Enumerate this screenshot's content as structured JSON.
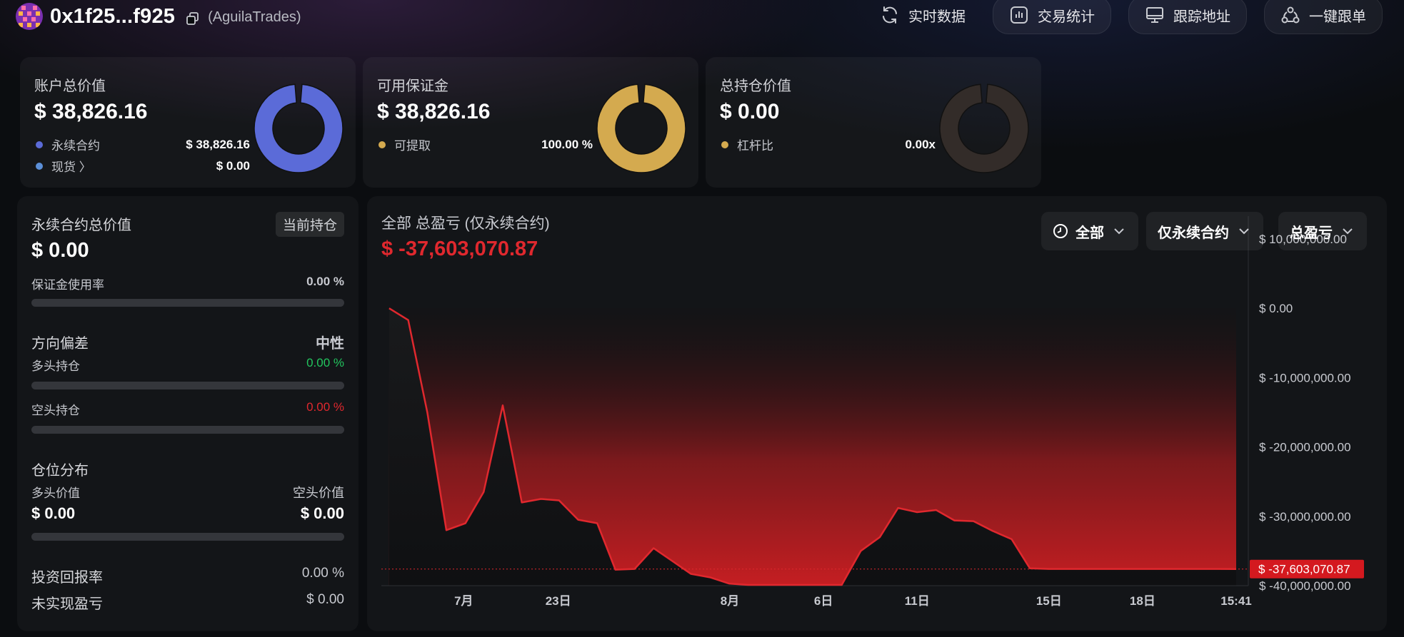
{
  "header": {
    "address": "0x1f25...f925",
    "alias": "(AguilaTrades)",
    "buttons": [
      {
        "label": "实时数据",
        "icon": "refresh-icon"
      },
      {
        "label": "交易统计",
        "icon": "bar-chart-icon"
      },
      {
        "label": "跟踪地址",
        "icon": "monitor-icon"
      },
      {
        "label": "一键跟单",
        "icon": "share-nodes-icon"
      }
    ]
  },
  "cards": [
    {
      "title": "账户总价值",
      "value": "$ 38,826.16",
      "rows": [
        {
          "label": "永续合约",
          "value": "$ 38,826.16",
          "color": "#5b6bd8"
        },
        {
          "label": "现货 〉",
          "value": "$ 0.00",
          "color": "#5b8fd8"
        }
      ],
      "donut_color": "#5b6bd8",
      "donut_fraction": 1.0
    },
    {
      "title": "可用保证金",
      "value": "$ 38,826.16",
      "rows": [
        {
          "label": "可提取",
          "value": "100.00 %",
          "color": "#d4aa4f"
        }
      ],
      "donut_color": "#d4aa4f",
      "donut_fraction": 1.0
    },
    {
      "title": "总持仓价值",
      "value": "$ 0.00",
      "rows": [
        {
          "label": "杠杆比",
          "value": "0.00x",
          "color": "#d4aa4f"
        }
      ],
      "donut_color": "#332c29",
      "donut_fraction": 1.0
    }
  ],
  "left_panel": {
    "title": "永续合约总价值",
    "badge": "当前持仓",
    "value": "$ 0.00",
    "margin_usage_label": "保证金使用率",
    "margin_usage_value": "0.00 %",
    "margin_usage_fraction": 0.0,
    "bias_label": "方向偏差",
    "bias_value": "中性",
    "long_label": "多头持仓",
    "long_value": "0.00 %",
    "long_fraction": 0.0,
    "short_label": "空头持仓",
    "short_value": "0.00 %",
    "short_fraction": 0.0,
    "dist_label": "仓位分布",
    "long_val_label": "多头价值",
    "short_val_label": "空头价值",
    "long_val": "$ 0.00",
    "short_val": "$ 0.00",
    "roi_label": "投资回报率",
    "roi_value": "0.00 %",
    "upnl_label": "未实现盈亏",
    "upnl_value": "$ 0.00",
    "colors": {
      "long": "#22c55e",
      "short": "#e0282e"
    }
  },
  "chart_panel": {
    "title": "全部 总盈亏 (仅永续合约)",
    "total": "$ -37,603,070.87",
    "dropdowns": [
      "全部",
      "仅永续合约",
      "总盈亏"
    ],
    "current_label": "$ -37,603,070.87"
  },
  "chart_data": {
    "type": "area",
    "ylim": [
      -40000000,
      10000000
    ],
    "yticks": [
      10000000,
      0,
      -10000000,
      -20000000,
      -30000000,
      -40000000
    ],
    "ytick_labels": [
      "$ 10,000,000.00",
      "$ 0.00",
      "$ -10,000,000.00",
      "$ -20,000,000.00",
      "$ -30,000,000.00",
      "$ -40,000,000.00"
    ],
    "xticks": [
      {
        "label": "7月",
        "pos": 0.095
      },
      {
        "label": "23日",
        "pos": 0.204
      },
      {
        "label": "8月",
        "pos": 0.402
      },
      {
        "label": "6日",
        "pos": 0.51
      },
      {
        "label": "11日",
        "pos": 0.618
      },
      {
        "label": "15日",
        "pos": 0.77
      },
      {
        "label": "18日",
        "pos": 0.878
      },
      {
        "label": "15:41",
        "pos": 0.986
      }
    ],
    "series": [
      {
        "values": [
          [
            0.009,
            0
          ],
          [
            0.031,
            -1700000
          ],
          [
            0.053,
            -15000000
          ],
          [
            0.075,
            -32000000
          ],
          [
            0.097,
            -31000000
          ],
          [
            0.118,
            -26500000
          ],
          [
            0.14,
            -14000000
          ],
          [
            0.162,
            -28000000
          ],
          [
            0.184,
            -27500000
          ],
          [
            0.205,
            -27700000
          ],
          [
            0.227,
            -30500000
          ],
          [
            0.249,
            -31000000
          ],
          [
            0.27,
            -37700000
          ],
          [
            0.292,
            -37600000
          ],
          [
            0.314,
            -34600000
          ],
          [
            0.335,
            -36400000
          ],
          [
            0.357,
            -38300000
          ],
          [
            0.379,
            -38800000
          ],
          [
            0.401,
            -39700000
          ],
          [
            0.423,
            -39900000
          ],
          [
            0.444,
            -39900000
          ],
          [
            0.466,
            -39900000
          ],
          [
            0.488,
            -39900000
          ],
          [
            0.51,
            -39900000
          ],
          [
            0.531,
            -39900000
          ],
          [
            0.553,
            -35000000
          ],
          [
            0.575,
            -33000000
          ],
          [
            0.596,
            -28800000
          ],
          [
            0.618,
            -29400000
          ],
          [
            0.64,
            -29100000
          ],
          [
            0.661,
            -30600000
          ],
          [
            0.683,
            -30700000
          ],
          [
            0.705,
            -32100000
          ],
          [
            0.727,
            -33300000
          ],
          [
            0.748,
            -37500000
          ],
          [
            0.77,
            -37600000
          ],
          [
            0.792,
            -37600000
          ],
          [
            0.813,
            -37600000
          ],
          [
            0.835,
            -37600000
          ],
          [
            0.857,
            -37600000
          ],
          [
            0.878,
            -37600000
          ],
          [
            0.9,
            -37600000
          ],
          [
            0.922,
            -37600000
          ],
          [
            0.943,
            -37600000
          ],
          [
            0.965,
            -37600000
          ],
          [
            0.986,
            -37603071
          ]
        ]
      }
    ],
    "current_value": -37603070.87,
    "line_color": "#e0282e",
    "grid": false
  }
}
